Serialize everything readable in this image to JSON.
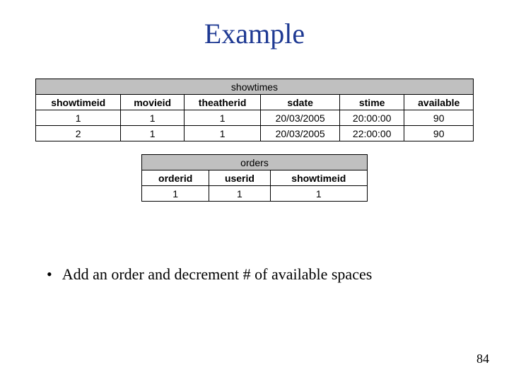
{
  "title": "Example",
  "showtimes": {
    "caption": "showtimes",
    "headers": [
      "showtimeid",
      "movieid",
      "theatherid",
      "sdate",
      "stime",
      "available"
    ],
    "rows": [
      [
        "1",
        "1",
        "1",
        "20/03/2005",
        "20:00:00",
        "90"
      ],
      [
        "2",
        "1",
        "1",
        "20/03/2005",
        "22:00:00",
        "90"
      ]
    ]
  },
  "orders": {
    "caption": "orders",
    "headers": [
      "orderid",
      "userid",
      "showtimeid"
    ],
    "rows": [
      [
        "1",
        "1",
        "1"
      ]
    ]
  },
  "bullet1": "Add an order and decrement # of available spaces",
  "pagenum": "84"
}
